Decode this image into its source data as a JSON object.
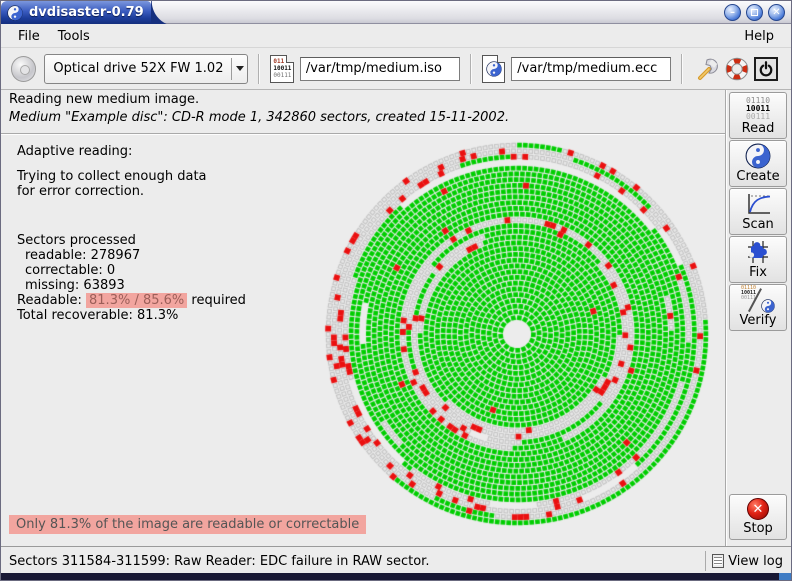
{
  "window": {
    "title": "dvdisaster-0.79"
  },
  "menubar": {
    "file": "File",
    "tools": "Tools",
    "help": "Help"
  },
  "toolbar": {
    "drive_value": "Optical drive 52X FW 1.02",
    "iso_value": "/var/tmp/medium.iso",
    "ecc_value": "/var/tmp/medium.ecc"
  },
  "header": {
    "title": "Reading new medium image.",
    "subtitle": "Medium \"Example disc\": CD-R mode 1, 342860 sectors, created 15-11-2002."
  },
  "info": {
    "mode": "Adaptive reading:",
    "desc_line1": "Trying to collect enough data",
    "desc_line2": "for error correction.",
    "sectors_title": "Sectors processed",
    "readable": "readable: 278967",
    "correctable": "correctable: 0",
    "missing": "missing: 63893",
    "readable_prefix": "Readable:",
    "readable_highlight": "81.3% / 85.6%",
    "readable_suffix": "required",
    "total": "Total recoverable: 81.3%"
  },
  "warning": {
    "text": "Only 81.3% of the image are readable or correctable"
  },
  "statusbar": {
    "message": "Sectors 311584-311599: Raw Reader: EDC failure in RAW sector.",
    "view_log": "View log"
  },
  "sidebar": {
    "buttons": [
      {
        "id": "read",
        "label": "Read"
      },
      {
        "id": "create",
        "label": "Create"
      },
      {
        "id": "scan",
        "label": "Scan"
      },
      {
        "id": "fix",
        "label": "Fix"
      },
      {
        "id": "verify",
        "label": "Verify"
      }
    ],
    "stop_label": "Stop",
    "binary_rows": [
      "01110",
      "10011",
      "00111"
    ],
    "iso_icon_rows": [
      "011",
      "10011",
      "00111"
    ]
  },
  "colors": {
    "titlebar_blue": "#2a4aa8",
    "warning_bg": "#f2a59f",
    "green": "#00ce00",
    "red": "#ea1010"
  },
  "spiral": {
    "center": [
      196,
      196
    ],
    "inner_radius": 13.5,
    "pitch": 5.75,
    "cell_size": 4.7,
    "ring_count": 31,
    "seed": 1337,
    "colors": {
      "green": "#00ce00",
      "gray_fill": "#e7e7e7",
      "gray_stroke": "#c2c2c2",
      "red": "#ea1010",
      "bg": "#ececec"
    },
    "bands": [
      {
        "from": 0,
        "to": 13,
        "weights": {
          "green": 0.96,
          "gray": 0.03,
          "missing": 0.01
        },
        "runs": {
          "green": [
            60,
            220
          ],
          "gray": [
            1,
            3
          ],
          "missing": [
            3,
            8
          ]
        },
        "red_on_gray": 0.05,
        "red_any": 0.004
      },
      {
        "from": 14,
        "to": 17,
        "weights": {
          "green": 0.38,
          "gray": 0.57,
          "missing": 0.05
        },
        "runs": {
          "green": [
            6,
            40
          ],
          "gray": [
            6,
            30
          ],
          "missing": [
            3,
            10
          ]
        },
        "red_on_gray": 0.12,
        "red_any": 0.004
      },
      {
        "from": 18,
        "to": 26,
        "weights": {
          "green": 0.9,
          "gray": 0.06,
          "missing": 0.04
        },
        "runs": {
          "green": [
            40,
            160
          ],
          "gray": [
            2,
            8
          ],
          "missing": [
            5,
            14
          ]
        },
        "red_on_gray": 0.12,
        "red_any": 0.008
      },
      {
        "from": 27,
        "to": 31,
        "weights": {
          "green": 0.3,
          "gray": 0.58,
          "missing": 0.12
        },
        "runs": {
          "green": [
            5,
            25
          ],
          "gray": [
            10,
            45
          ],
          "missing": [
            6,
            22
          ]
        },
        "red_on_gray": 0.12,
        "red_any": 0.006
      }
    ]
  }
}
